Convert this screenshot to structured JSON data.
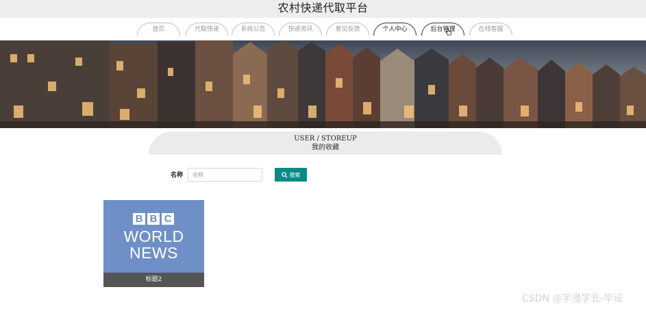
{
  "site": {
    "title": "农村快递代取平台"
  },
  "nav": {
    "items": [
      {
        "label": "首页",
        "active": false
      },
      {
        "label": "代取快递",
        "active": false
      },
      {
        "label": "系统公告",
        "active": false
      },
      {
        "label": "快递资讯",
        "active": false
      },
      {
        "label": "意见反馈",
        "active": false
      },
      {
        "label": "个人中心",
        "active": true
      },
      {
        "label": "后台管理",
        "active": true
      },
      {
        "label": "在线客服",
        "active": false
      }
    ]
  },
  "breadcrumb": {
    "path": "USER / STOREUP",
    "title": "我的收藏"
  },
  "search": {
    "label": "名称",
    "placeholder": "名称",
    "value": "",
    "button": "搜索"
  },
  "items": [
    {
      "caption": "标题2",
      "image": {
        "logo_blocks": [
          "B",
          "B",
          "C"
        ],
        "line1": "WORLD",
        "line2": "NEWS",
        "color": "#6e90c6"
      }
    }
  ],
  "watermark": "CSDN @宇澄学长-毕设",
  "colors": {
    "accent": "#0b8a86",
    "topbar": "#ededed",
    "caption_bg": "#555555"
  }
}
